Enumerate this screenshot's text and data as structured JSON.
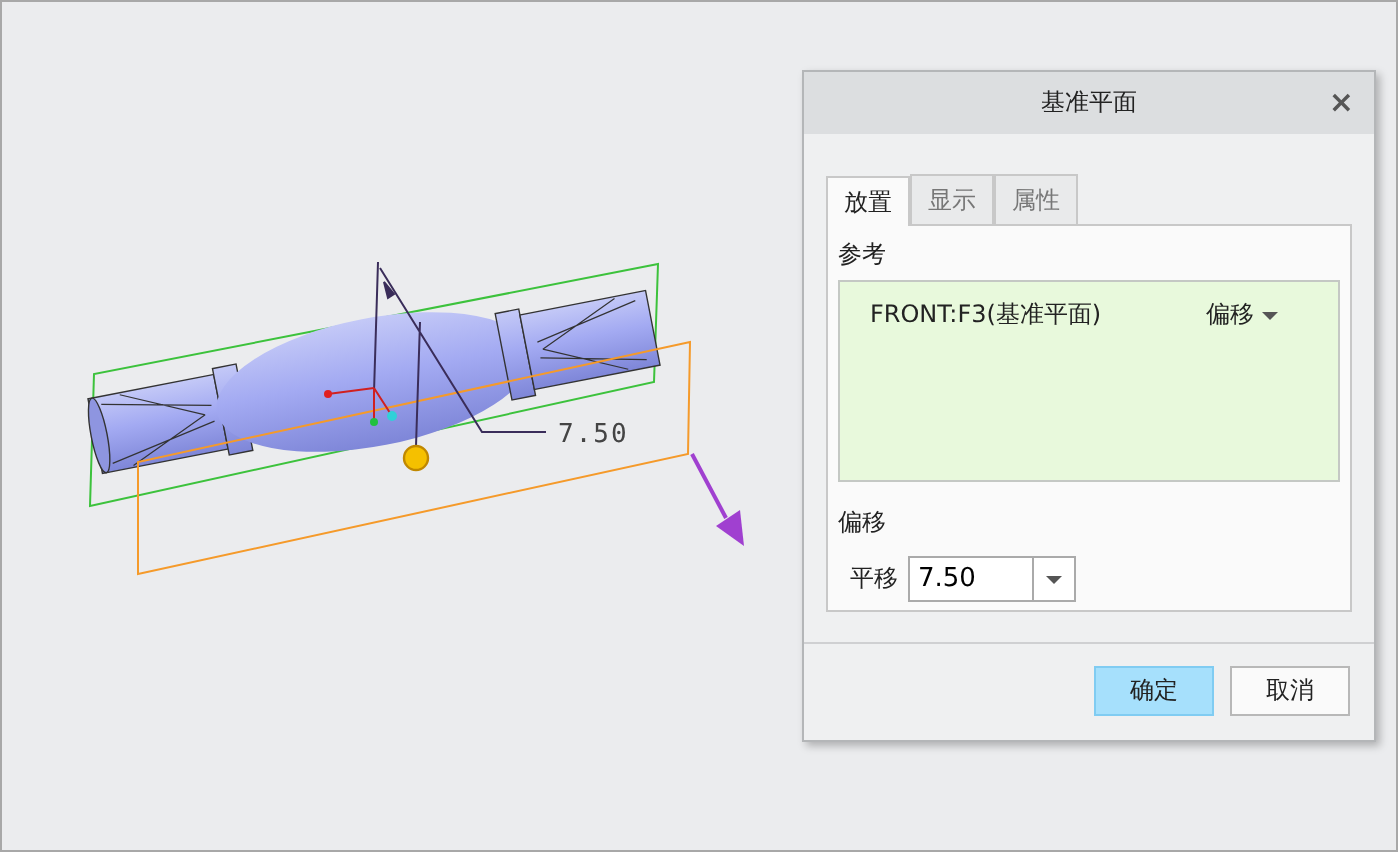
{
  "viewport": {
    "dimension_label": "7.50"
  },
  "dialog": {
    "title": "基准平面",
    "close": "×",
    "tabs": [
      {
        "label": "放置",
        "selected": true
      },
      {
        "label": "显示",
        "selected": false
      },
      {
        "label": "属性",
        "selected": false
      }
    ],
    "references_label": "参考",
    "references": [
      {
        "name": "FRONT:F3(基准平面)",
        "constraint": "偏移",
        "selected": false
      }
    ],
    "offset_label": "偏移",
    "translation": {
      "label": "平移",
      "value": "7.50"
    },
    "buttons": [
      {
        "label": "确定",
        "kind": "primary"
      },
      {
        "label": "取消",
        "kind": "secondary"
      }
    ]
  }
}
